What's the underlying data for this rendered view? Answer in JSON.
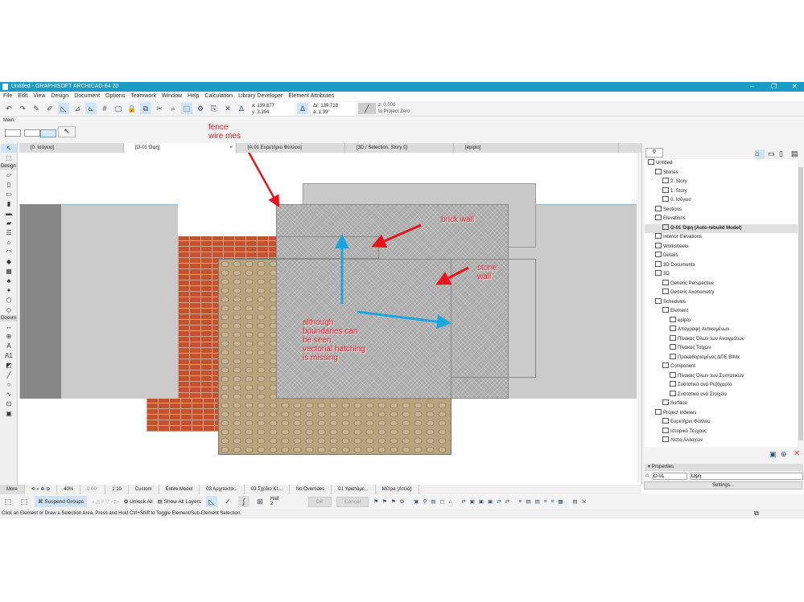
{
  "window": {
    "title": "Untitled - GRAPHISOFT ARCHICAD-64 20"
  },
  "menu": [
    "File",
    "Edit",
    "View",
    "Design",
    "Document",
    "Options",
    "Teamwork",
    "Window",
    "Help",
    "Calculation",
    "Library Developer",
    "Element Attributes"
  ],
  "coords": {
    "x": "x: 139.677",
    "y": "y: 3.394",
    "dr": "Δr: 139.718",
    "a": "a: 1.39°",
    "z": "z: 0.000",
    "ref": "to Project Zero"
  },
  "main_label": "Main:",
  "tabs": [
    "[0. Ισόγειο]",
    "[O-01 Όψη]",
    "[A.01 Ευρετήριο Φύλλου]",
    "[3D / Selection, Story 0]",
    "[epiplo]"
  ],
  "toolbox": {
    "design": "Design",
    "document": "Docum",
    "more": "More"
  },
  "annotations": {
    "fence": "fence\nwire mes",
    "brick": "brick wall",
    "stone": "stone\nwall",
    "note": "although\nboundaries can\nbe seen,\nvectorial hatching\nis missing"
  },
  "navigator": [
    {
      "label": "Untitled",
      "lvl": 0
    },
    {
      "label": "Stories",
      "lvl": 1
    },
    {
      "label": "2. Story",
      "lvl": 2
    },
    {
      "label": "1. Story",
      "lvl": 2
    },
    {
      "label": "0. Ισόγειο",
      "lvl": 2
    },
    {
      "label": "Sections",
      "lvl": 1
    },
    {
      "label": "Elevations",
      "lvl": 1
    },
    {
      "label": "O-01 Όψη (Auto-rebuild Model)",
      "lvl": 2,
      "sel": true
    },
    {
      "label": "Interior Elevations",
      "lvl": 1
    },
    {
      "label": "Worksheets",
      "lvl": 1
    },
    {
      "label": "Details",
      "lvl": 1
    },
    {
      "label": "3D Documents",
      "lvl": 1
    },
    {
      "label": "3D",
      "lvl": 1
    },
    {
      "label": "Generic Perspective",
      "lvl": 2
    },
    {
      "label": "Generic Axonometry",
      "lvl": 2
    },
    {
      "label": "Schedules",
      "lvl": 1
    },
    {
      "label": "Element",
      "lvl": 2
    },
    {
      "label": "epiplo",
      "lvl": 3
    },
    {
      "label": "Απογραφή Αντικειμένων",
      "lvl": 3
    },
    {
      "label": "Πίνακας Όλων των Ανοιγμάτων",
      "lvl": 3
    },
    {
      "label": "Πίνακας Τοίχων",
      "lvl": 3
    },
    {
      "label": "Προκαθορισμένος ΔΠΕ BIMx",
      "lvl": 3
    },
    {
      "label": "Component",
      "lvl": 2
    },
    {
      "label": "Πίνακας Όλων των Συστατικών",
      "lvl": 3
    },
    {
      "label": "Συστατικά ανά Ρεζόχαρτο",
      "lvl": 3
    },
    {
      "label": "Συστατικά ανά Στοιχείο",
      "lvl": 3
    },
    {
      "label": "Surface",
      "lvl": 2
    },
    {
      "label": "Project Indexes",
      "lvl": 1
    },
    {
      "label": "Ευρετήριο Φύλλου",
      "lvl": 2
    },
    {
      "label": "Ιστορικό Τεύχους",
      "lvl": 2
    },
    {
      "label": "Λίστα Αλλαγών",
      "lvl": 2
    }
  ],
  "properties": {
    "title": "Properties",
    "id": "O-01",
    "name": "Όψη",
    "settings": "Settings..."
  },
  "bottom": {
    "zoom": "40%",
    "angle": "0.00°",
    "scale": "1:10",
    "custom": "Custom",
    "model": "Entire Model",
    "pen": "03 Αρχιτεκτο...",
    "mvo": "03 Σχέδιο Κτ...",
    "overrides": "No Overrides",
    "renov": "01 Υφιστάμε...",
    "dim": "Μέτρα (Απλό)"
  },
  "toolbar2": {
    "suspend": "Suspend Groups",
    "unlock": "Unlock All",
    "layers": "Show All Layers",
    "half": "Half",
    "half_n": "2",
    "ok": "OK",
    "cancel": "Cancel"
  },
  "status": "Click an Element or Draw a Selection Area. Press and Hold Ctrl+Shift to Toggle Element/Sub-Element Selection."
}
